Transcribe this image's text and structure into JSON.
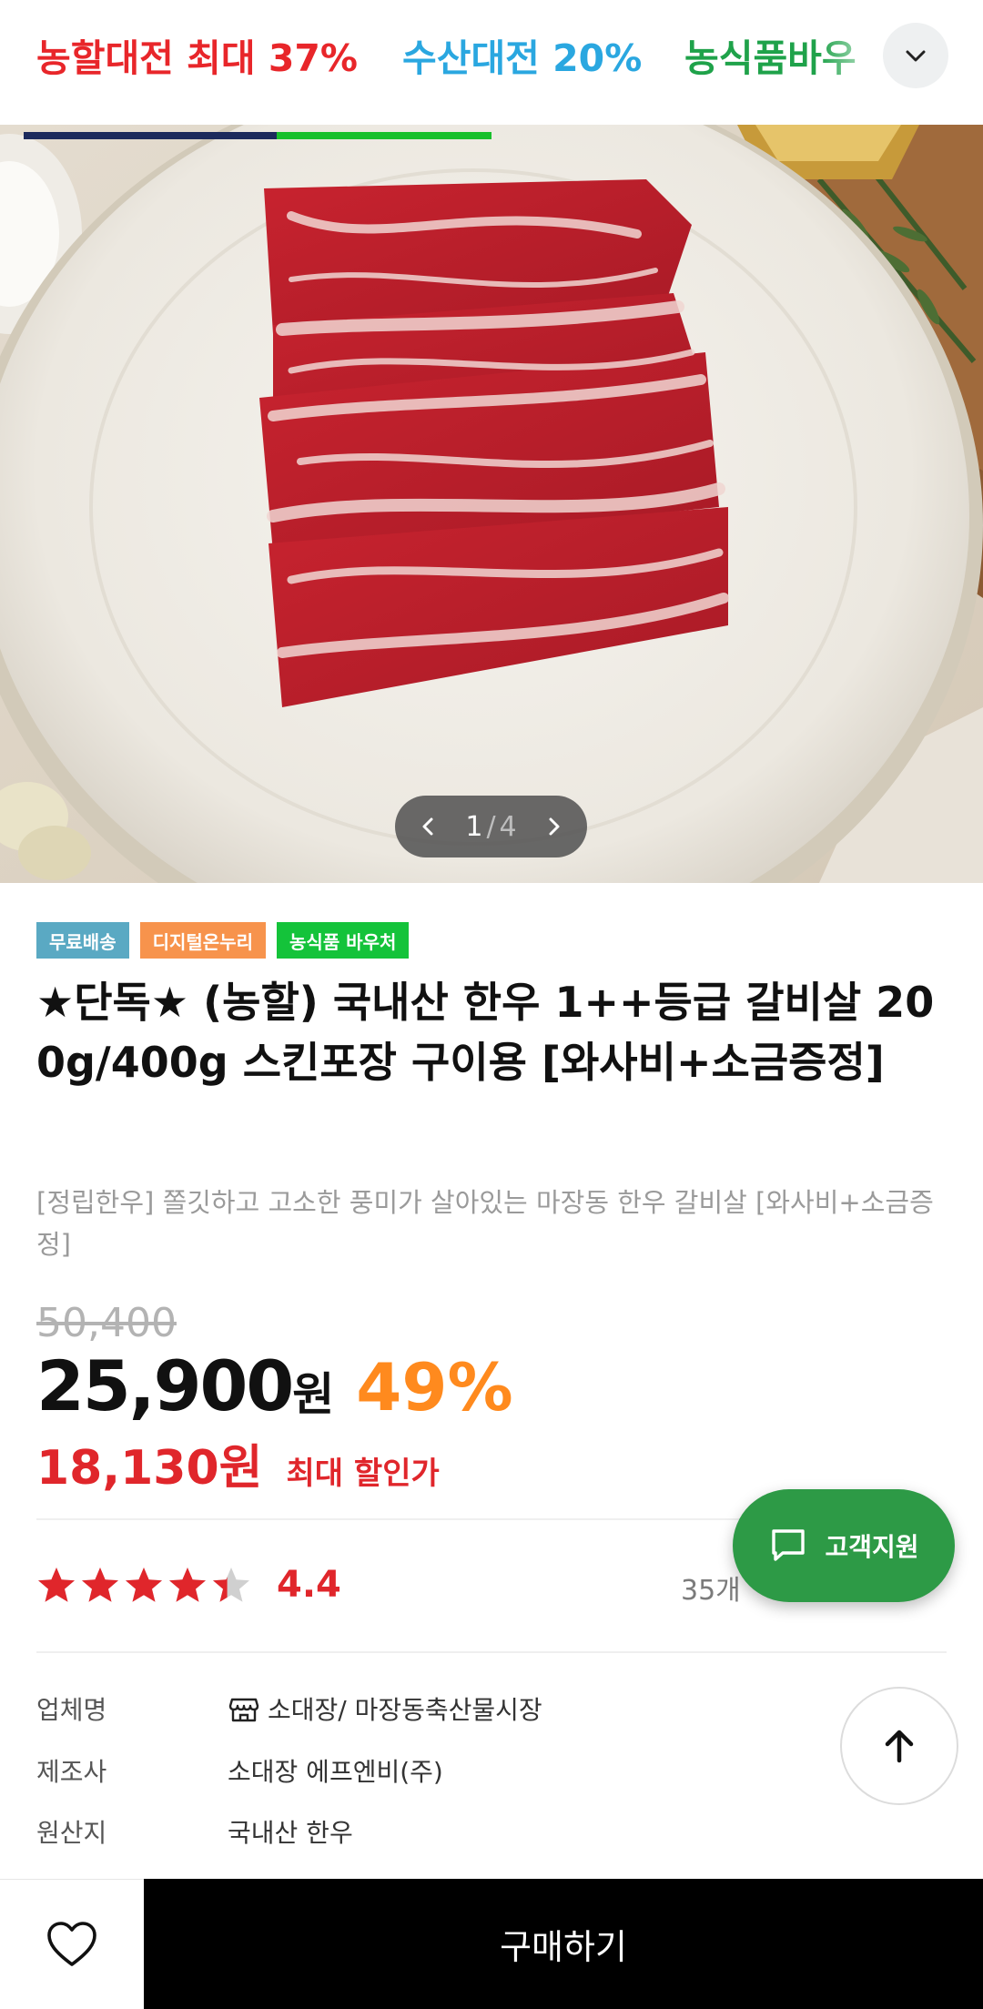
{
  "tabs": [
    {
      "label": "농할대전 최대 37%",
      "color": "#e8262a"
    },
    {
      "label": "수산대전 20%",
      "color": "#2aa7e0"
    },
    {
      "label": "농식품바우",
      "color": "#1fa24a"
    }
  ],
  "tab_underline_colors": [
    "#1c2a5c",
    "#17c02b"
  ],
  "expand_icon": "chevron-down-icon",
  "hero": {
    "pager_current": "1",
    "pager_separator": "/",
    "pager_total": "4"
  },
  "badges": [
    {
      "label": "무료배송",
      "bg": "#5aa9c3"
    },
    {
      "label": "디지털온누리",
      "bg": "#f7934c"
    },
    {
      "label": "농식품 바우처",
      "bg": "#14c33a"
    }
  ],
  "product": {
    "title": "★단독★ (농할) 국내산 한우 1++등급 갈비살 200g/400g 스킨포장 구이용 [와사비+소금증정]",
    "subtitle": "[정립한우] 쫄깃하고 고소한 풍미가 살아있는 마장동 한우 갈비살 [와사비+소금증정]",
    "original_price": "50,400",
    "price": "25,900",
    "price_unit": "원",
    "discount_rate": "49%",
    "max_discount_price": "18,130원",
    "max_discount_label": "최대 할인가"
  },
  "rating": {
    "value": "4.4",
    "stars_out_of_5": 4.4,
    "review_count_visible": "35개"
  },
  "info": [
    {
      "label": "업체명",
      "value": "소대장/ 마장동축산물시장",
      "icon": "store-icon"
    },
    {
      "label": "제조사",
      "value": "소대장 에프엔비(주)"
    },
    {
      "label": "원산지",
      "value": "국내산 한우"
    }
  ],
  "support_button": {
    "label": "고객지원",
    "icon": "chat-icon",
    "color": "#2d9a46"
  },
  "scroll_top_icon": "arrow-up-icon",
  "bottom": {
    "wishlist_icon": "heart-icon",
    "buy_label": "구매하기"
  }
}
